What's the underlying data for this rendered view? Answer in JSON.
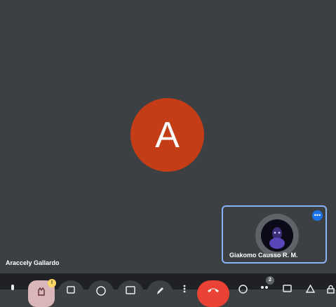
{
  "main_participant": {
    "initial": "A",
    "name": "Araccely Gallardo",
    "avatar_color": "#c43d16"
  },
  "self_tile": {
    "name": "Giakomo Causso R. M.",
    "more_label": "•••",
    "border_color": "#8ab4f8"
  },
  "toolbar": {
    "hand_badge": "!",
    "people_badge": "2",
    "end_call_color": "#ea4335",
    "icons": [
      "mic-icon",
      "raise-hand-icon",
      "captions-icon",
      "emoji-icon",
      "present-icon",
      "pen-icon",
      "more-vert-icon",
      "end-call-icon",
      "info-icon",
      "people-icon",
      "chat-icon",
      "activities-icon",
      "lock-icon"
    ]
  }
}
